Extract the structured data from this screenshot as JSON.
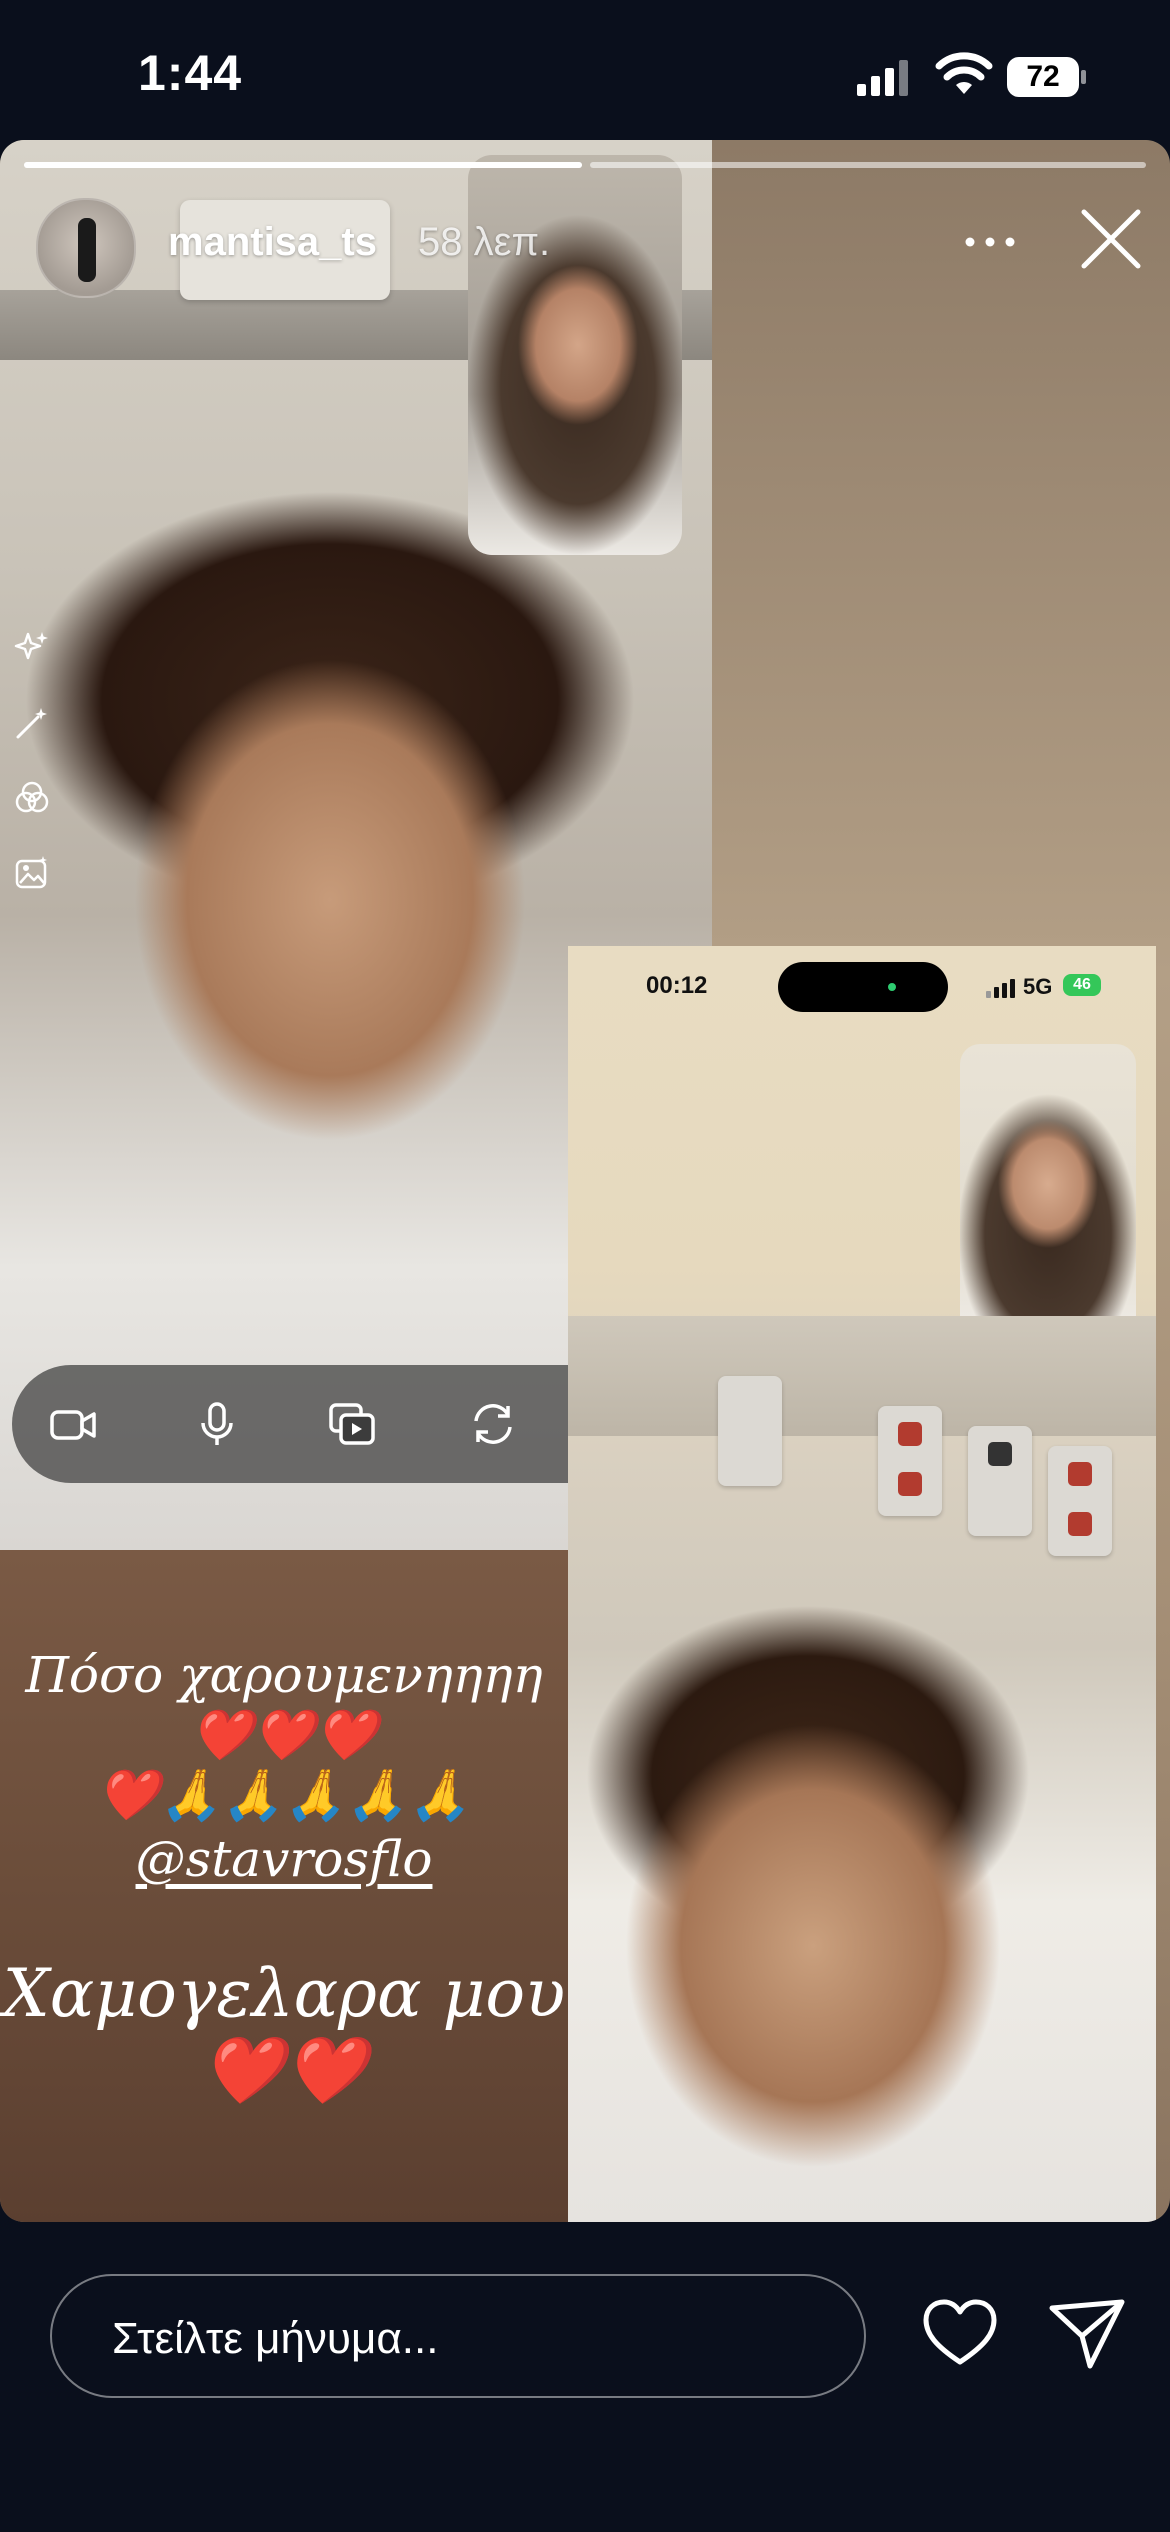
{
  "status_bar": {
    "time": "1:44",
    "battery": "72"
  },
  "story": {
    "username": "mantisa_ts",
    "posted_ago": "58 λεπ.",
    "progress": [
      1.0,
      0.0
    ],
    "caption_line1": "Πόσο χαρουμενηηηη❤️❤️❤️",
    "caption_line2": "❤️🙏🙏🙏🙏🙏",
    "mention": "@stavrosflo",
    "caption_line3": "Χαμογελαρα μου❤️❤️"
  },
  "screenshot": {
    "time": "00:12",
    "network": "5G",
    "battery": "46"
  },
  "reply": {
    "placeholder": "Στείλτε μήνυμα..."
  },
  "colors": {
    "background": "#0a0f1c",
    "caption_panel": "#6b4d3a"
  }
}
